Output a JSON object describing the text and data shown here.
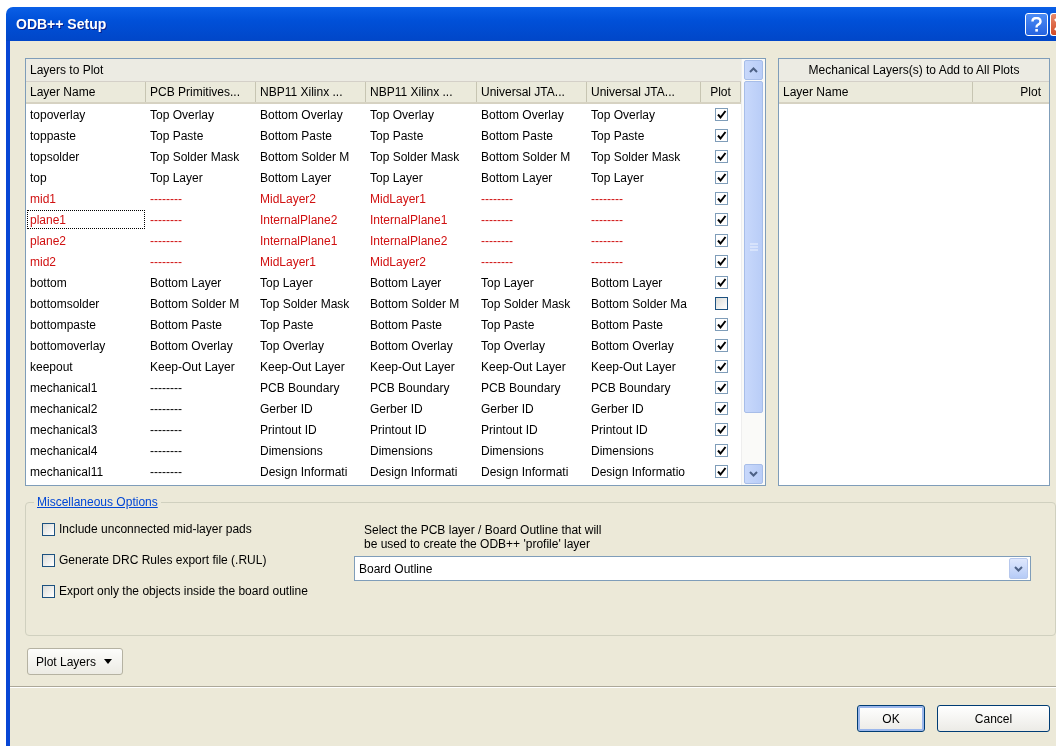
{
  "window": {
    "title": "ODB++ Setup"
  },
  "layers_table": {
    "title": "Layers to Plot",
    "columns": [
      "Layer Name",
      "PCB Primitives...",
      "NBP11 Xilinx ...",
      "NBP11 Xilinx ...",
      "Universal JTA...",
      "Universal JTA...",
      "Plot"
    ],
    "rows": [
      {
        "cells": [
          "topoverlay",
          "Top Overlay",
          "Bottom Overlay",
          "Top Overlay",
          "Bottom Overlay",
          "Top Overlay"
        ],
        "plot": true,
        "highlighted": false,
        "focused": false
      },
      {
        "cells": [
          "toppaste",
          "Top Paste",
          "Bottom Paste",
          "Top Paste",
          "Bottom Paste",
          "Top Paste"
        ],
        "plot": true,
        "highlighted": false,
        "focused": false
      },
      {
        "cells": [
          "topsolder",
          "Top Solder Mask",
          "Bottom Solder M",
          "Top Solder Mask",
          "Bottom Solder M",
          "Top Solder Mask"
        ],
        "plot": true,
        "highlighted": false,
        "focused": false
      },
      {
        "cells": [
          "top",
          "Top Layer",
          "Bottom Layer",
          "Top Layer",
          "Bottom Layer",
          "Top Layer"
        ],
        "plot": true,
        "highlighted": false,
        "focused": false
      },
      {
        "cells": [
          "mid1",
          "--------",
          "MidLayer2",
          "MidLayer1",
          "--------",
          "--------"
        ],
        "plot": true,
        "highlighted": true,
        "focused": false
      },
      {
        "cells": [
          "plane1",
          "--------",
          "InternalPlane2",
          "InternalPlane1",
          "--------",
          "--------"
        ],
        "plot": true,
        "highlighted": true,
        "focused": true
      },
      {
        "cells": [
          "plane2",
          "--------",
          "InternalPlane1",
          "InternalPlane2",
          "--------",
          "--------"
        ],
        "plot": true,
        "highlighted": true,
        "focused": false
      },
      {
        "cells": [
          "mid2",
          "--------",
          "MidLayer1",
          "MidLayer2",
          "--------",
          "--------"
        ],
        "plot": true,
        "highlighted": true,
        "focused": false
      },
      {
        "cells": [
          "bottom",
          "Bottom Layer",
          "Top Layer",
          "Bottom Layer",
          "Top Layer",
          "Bottom Layer"
        ],
        "plot": true,
        "highlighted": false,
        "focused": false
      },
      {
        "cells": [
          "bottomsolder",
          "Bottom Solder M",
          "Top Solder Mask",
          "Bottom Solder M",
          "Top Solder Mask",
          "Bottom Solder Ma"
        ],
        "plot": false,
        "highlighted": false,
        "focused": false
      },
      {
        "cells": [
          "bottompaste",
          "Bottom Paste",
          "Top Paste",
          "Bottom Paste",
          "Top Paste",
          "Bottom Paste"
        ],
        "plot": true,
        "highlighted": false,
        "focused": false
      },
      {
        "cells": [
          "bottomoverlay",
          "Bottom Overlay",
          "Top Overlay",
          "Bottom Overlay",
          "Top Overlay",
          "Bottom Overlay"
        ],
        "plot": true,
        "highlighted": false,
        "focused": false
      },
      {
        "cells": [
          "keepout",
          "Keep-Out Layer",
          "Keep-Out Layer",
          "Keep-Out Layer",
          "Keep-Out Layer",
          "Keep-Out Layer"
        ],
        "plot": true,
        "highlighted": false,
        "focused": false
      },
      {
        "cells": [
          "mechanical1",
          "--------",
          "PCB Boundary",
          "PCB Boundary",
          "PCB Boundary",
          "PCB Boundary"
        ],
        "plot": true,
        "highlighted": false,
        "focused": false
      },
      {
        "cells": [
          "mechanical2",
          "--------",
          "Gerber ID",
          "Gerber ID",
          "Gerber ID",
          "Gerber ID"
        ],
        "plot": true,
        "highlighted": false,
        "focused": false
      },
      {
        "cells": [
          "mechanical3",
          "--------",
          "Printout ID",
          "Printout ID",
          "Printout ID",
          "Printout ID"
        ],
        "plot": true,
        "highlighted": false,
        "focused": false
      },
      {
        "cells": [
          "mechanical4",
          "--------",
          "Dimensions",
          "Dimensions",
          "Dimensions",
          "Dimensions"
        ],
        "plot": true,
        "highlighted": false,
        "focused": false
      },
      {
        "cells": [
          "mechanical11",
          "--------",
          "Design Informati",
          "Design Informati",
          "Design Informati",
          "Design Informatio"
        ],
        "plot": true,
        "highlighted": false,
        "focused": false
      }
    ]
  },
  "mechanical_panel": {
    "title": "Mechanical Layers(s) to Add to All Plots",
    "columns": [
      "Layer Name",
      "Plot"
    ]
  },
  "misc_options": {
    "title": "Miscellaneous Options",
    "options": [
      {
        "label": "Include unconnected mid-layer pads",
        "checked": false
      },
      {
        "label": "Generate DRC Rules export file (.RUL)",
        "checked": false
      },
      {
        "label": "Export only the objects inside the board outline",
        "checked": false
      }
    ],
    "profile_hint": "Select the PCB layer / Board Outline that will\nbe used to create the ODB++ 'profile' layer",
    "profile_value": "Board Outline"
  },
  "plot_layers_button": "Plot Layers",
  "buttons": [
    "OK",
    "Cancel"
  ]
}
